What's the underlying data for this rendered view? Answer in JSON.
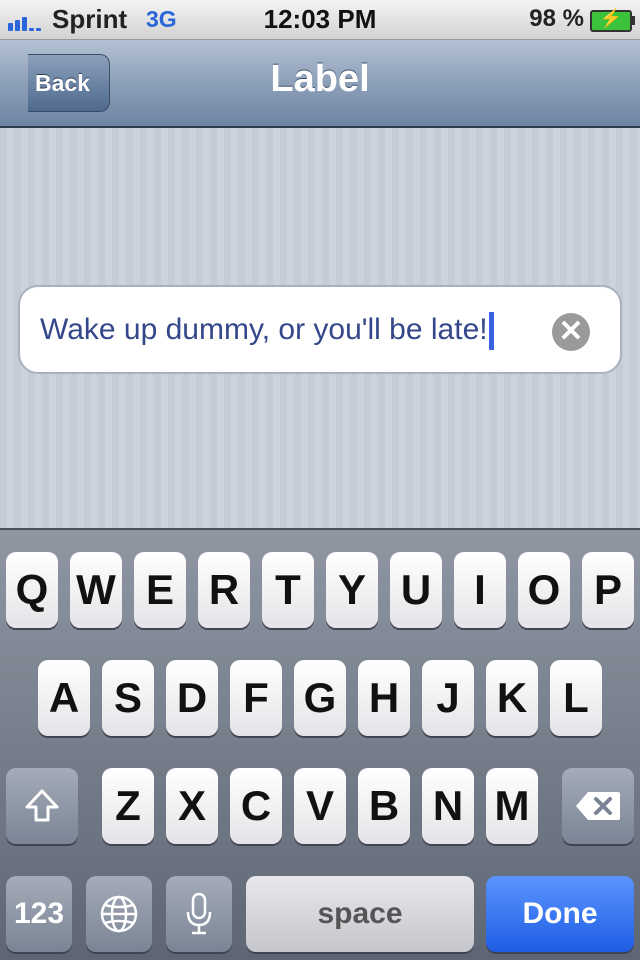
{
  "status_bar": {
    "carrier": "Sprint",
    "network": "3G",
    "time": "12:03 PM",
    "battery_percent": "98 %",
    "battery_icon": "battery-charging-icon",
    "accent_color": "#2a66d9"
  },
  "nav_bar": {
    "back_label": "Back",
    "title": "Label"
  },
  "text_field": {
    "value": "Wake up dummy, or you'll be late!",
    "clear_icon": "clear-x-icon"
  },
  "keyboard": {
    "row1": [
      "Q",
      "W",
      "E",
      "R",
      "T",
      "Y",
      "U",
      "I",
      "O",
      "P"
    ],
    "row2": [
      "A",
      "S",
      "D",
      "F",
      "G",
      "H",
      "J",
      "K",
      "L"
    ],
    "row3": [
      "Z",
      "X",
      "C",
      "V",
      "B",
      "N",
      "M"
    ],
    "shift_icon": "shift-arrow-icon",
    "delete_icon": "delete-backspace-icon",
    "numbers_label": "123",
    "globe_icon": "globe-icon",
    "mic_icon": "microphone-icon",
    "space_label": "space",
    "done_label": "Done",
    "done_color": "#1d5de3"
  }
}
